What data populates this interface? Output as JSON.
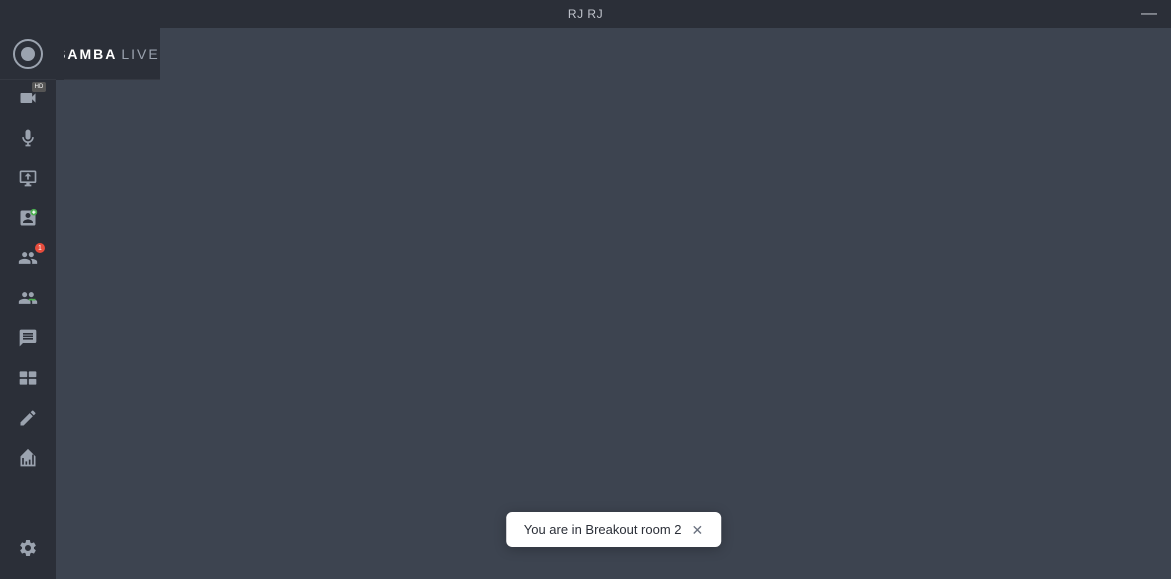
{
  "topbar": {
    "title": "RJ RJ",
    "minimize_label": "—"
  },
  "logo": {
    "brand": "SAMBA",
    "brand_suffix": " LIVE"
  },
  "sidebar": {
    "icons": [
      {
        "id": "camera",
        "label": "Camera",
        "badge": "HD"
      },
      {
        "id": "microphone",
        "label": "Microphone"
      },
      {
        "id": "screen-share",
        "label": "Screen Share"
      },
      {
        "id": "add-speaker",
        "label": "Add Speaker"
      },
      {
        "id": "participants",
        "label": "Participants",
        "badge_count": "1"
      },
      {
        "id": "manage-participants",
        "label": "Manage Participants"
      },
      {
        "id": "chat",
        "label": "Chat"
      },
      {
        "id": "video-tile",
        "label": "Video Tile"
      },
      {
        "id": "annotate",
        "label": "Annotate"
      },
      {
        "id": "stats",
        "label": "Statistics"
      }
    ],
    "bottom_icons": [
      {
        "id": "settings",
        "label": "Settings"
      }
    ]
  },
  "toast": {
    "message": "You are in Breakout room 2",
    "close_label": "✕"
  }
}
